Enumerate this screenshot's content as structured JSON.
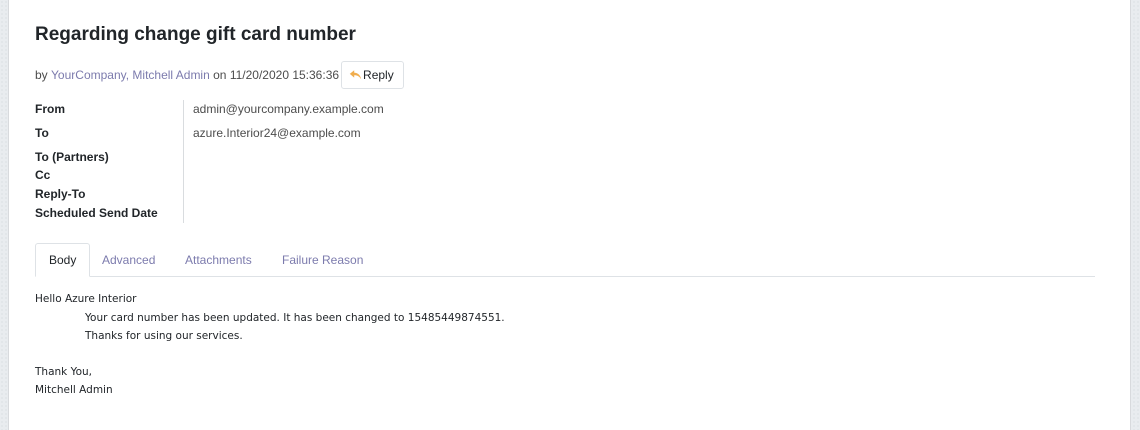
{
  "message": {
    "subject": "Regarding change gift card number",
    "byline": {
      "prefix": "by",
      "authors": "YourCompany, Mitchell Admin",
      "on_word": "on",
      "date": "11/20/2020 15:36:36"
    },
    "reply_label": "Reply"
  },
  "fields": {
    "from": {
      "label": "From",
      "value": "admin@yourcompany.example.com"
    },
    "to": {
      "label": "To",
      "value": "azure.Interior24@example.com"
    },
    "to_partners": {
      "label": "To (Partners)",
      "value": ""
    },
    "cc": {
      "label": "Cc",
      "value": ""
    },
    "reply_to": {
      "label": "Reply-To",
      "value": ""
    },
    "scheduled_send_date": {
      "label": "Scheduled Send Date",
      "value": ""
    }
  },
  "tabs": [
    {
      "label": "Body",
      "active": true
    },
    {
      "label": "Advanced",
      "active": false
    },
    {
      "label": "Attachments",
      "active": false
    },
    {
      "label": "Failure Reason",
      "active": false
    }
  ],
  "body": {
    "greeting": "Hello Azure Interior",
    "line1": "Your card number has been updated. It has been changed to 15485449874551.",
    "line2": "Thanks for using our services.",
    "closing": "Thank You,",
    "signature": "Mitchell Admin"
  },
  "colors": {
    "link": "#7c7bad",
    "reply_icon": "#f0ad4e",
    "title": "#212529"
  },
  "icons": {
    "reply": "reply-arrow-icon"
  }
}
